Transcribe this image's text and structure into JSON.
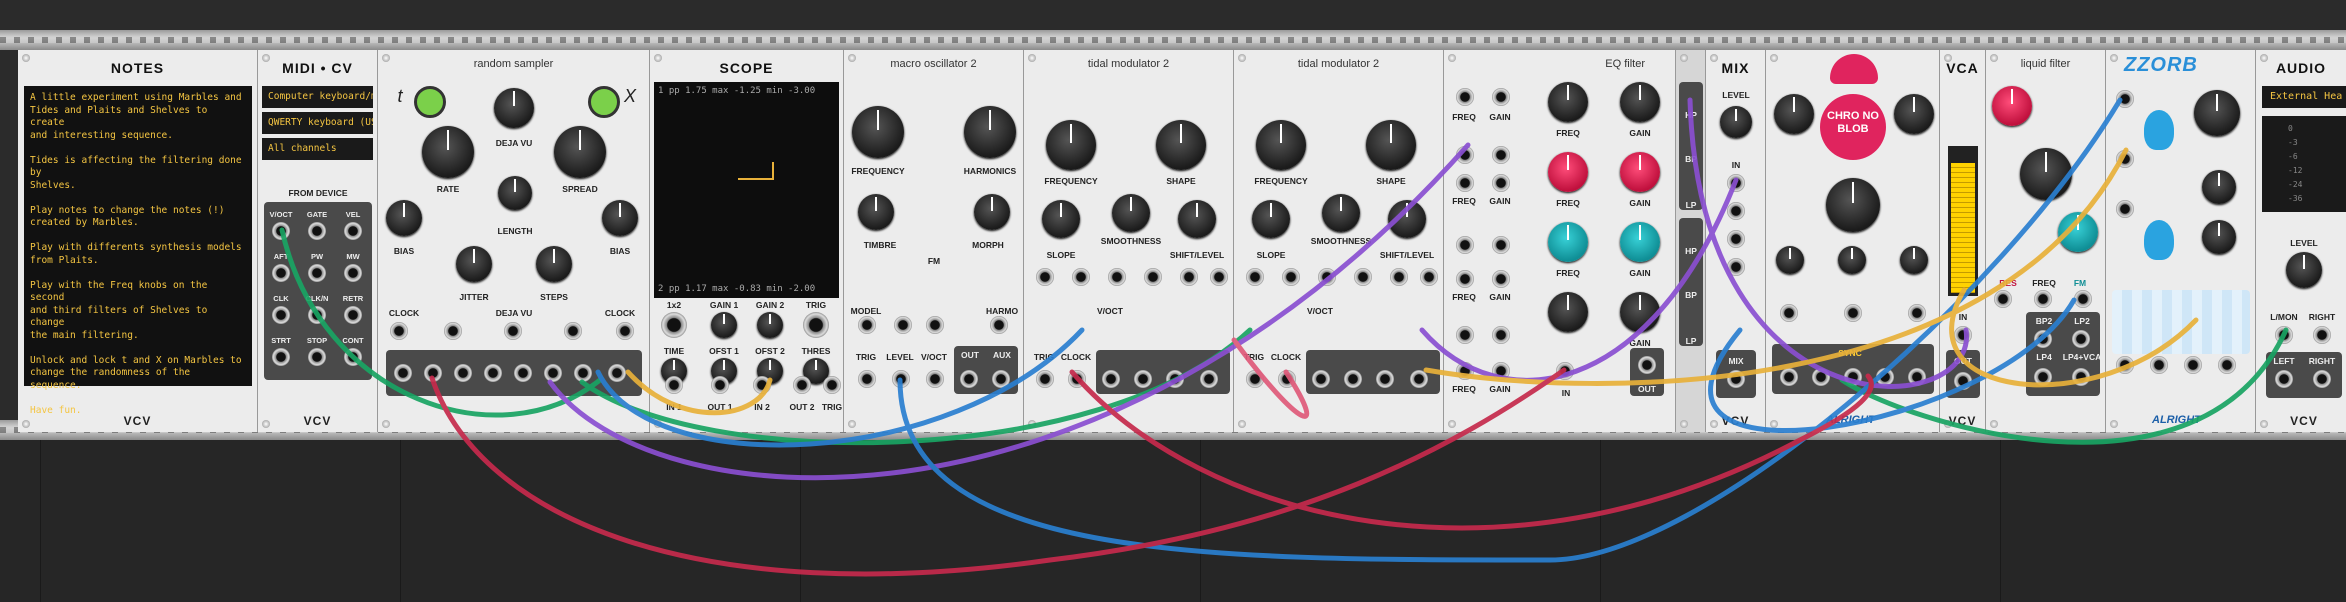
{
  "notes": {
    "title": "NOTES",
    "brand": "VCV",
    "text": "A little experiment using Marbles and\nTides and Plaits and Shelves to create\nand interesting sequence.\n\nTides is affecting the filtering done by\nShelves.\n\nPlay notes to change the notes (!)\ncreated by Marbles.\n\nPlay with differents synthesis models\nfrom Plaits.\n\nPlay with the Freq knobs on the second\nand third filters of Shelves to change\nthe main filtering.\n\nUnlock and lock t and X on Marbles to\nchange the randomness of the sequence.\n\nHave fun."
  },
  "midi_cv": {
    "title": "MIDI • CV",
    "brand": "VCV",
    "driver": "Computer keyboard/mo",
    "device": "QWERTY keyboard (US)",
    "channel": "All channels",
    "from_device": "FROM DEVICE",
    "outputs": [
      "V/OCT",
      "GATE",
      "VEL",
      "AFT",
      "PW",
      "MW",
      "CLK",
      "CLK/N",
      "RETR",
      "STRT",
      "STOP",
      "CONT"
    ]
  },
  "random_sampler": {
    "title": "random sampler",
    "t_label": "t",
    "x_label": "X",
    "labels": [
      "RATE",
      "DEJA VU",
      "SPREAD",
      "BIAS",
      "LENGTH",
      "BIAS",
      "JITTER",
      "STEPS",
      "CLOCK",
      "DEJA VU",
      "CLOCK"
    ]
  },
  "scope": {
    "title": "SCOPE",
    "ch1": "1   pp   1.75    max  -1.25   min  -3.00",
    "ch2": "2   pp   1.17    max  -0.83   min  -2.00",
    "labels": [
      "1x2",
      "GAIN 1",
      "GAIN 2",
      "TRIG",
      "TIME",
      "OFST 1",
      "OFST 2",
      "THRES",
      "IN 1",
      "OUT 1",
      "IN 2",
      "OUT 2",
      "TRIG"
    ]
  },
  "macro_osc": {
    "title": "macro oscillator 2",
    "labels": [
      "FREQUENCY",
      "HARMONICS",
      "TIMBRE",
      "MORPH",
      "MODEL",
      "FM",
      "HARMO",
      "TRIG",
      "LEVEL",
      "V/OCT",
      "OUT",
      "AUX"
    ]
  },
  "tidal1": {
    "title": "tidal modulator 2",
    "labels": [
      "FREQUENCY",
      "SHAPE",
      "SLOPE",
      "SMOOTHNESS",
      "SHIFT/LEVEL",
      "V/OCT",
      "TRIG",
      "CLOCK"
    ]
  },
  "tidal2": {
    "title": "tidal modulator 2",
    "labels": [
      "FREQUENCY",
      "SHAPE",
      "SLOPE",
      "SMOOTHNESS",
      "SHIFT/LEVEL",
      "V/OCT",
      "TRIG",
      "CLOCK"
    ]
  },
  "eq_filter": {
    "title": "EQ filter",
    "labels": [
      "FREQ",
      "GAIN",
      "GAIN",
      "FREQ",
      "GAIN",
      "FREQ",
      "GAIN",
      "FREQ",
      "GAIN",
      "FREQ",
      "GAIN",
      "FREQ",
      "GAIN",
      "FREQ",
      "GAIN",
      "IN",
      "OUT"
    ],
    "side": [
      "HP",
      "BP",
      "LP",
      "HP",
      "BP",
      "LP"
    ]
  },
  "mix": {
    "title": "MIX",
    "level": "LEVEL",
    "in": "IN",
    "mix": "MIX",
    "brand": "VCV"
  },
  "chronoblob": {
    "logo": "CHRO NO BLOB",
    "sync": "SYNC",
    "brand": "ALRIGHT"
  },
  "vca": {
    "title": "VCA",
    "in": "IN",
    "out": "OUT",
    "brand": "VCV",
    "level": 0.9
  },
  "liquid": {
    "title": "liquid filter",
    "labels": [
      "RES",
      "FREQ",
      "FM",
      "BP2",
      "LP2",
      "LP4",
      "LP4+VCA"
    ]
  },
  "zzorb": {
    "title": "ZZORB",
    "brand": "ALRIGHT"
  },
  "audio": {
    "title": "AUDIO",
    "device": "External Hea",
    "vu": [
      "0",
      "-3",
      "-6",
      "-12",
      "-24",
      "-36"
    ],
    "level": "LEVEL",
    "lmon": "L/MON",
    "right_in": "RIGHT",
    "left": "LEFT",
    "right": "RIGHT",
    "brand": "VCV"
  },
  "colors": {
    "green": "#19a463",
    "purple": "#8a4fd1",
    "blue": "#2a7fd0",
    "yellow": "#e8b13a",
    "red": "#c62a4c",
    "pink": "#e05a7a"
  }
}
